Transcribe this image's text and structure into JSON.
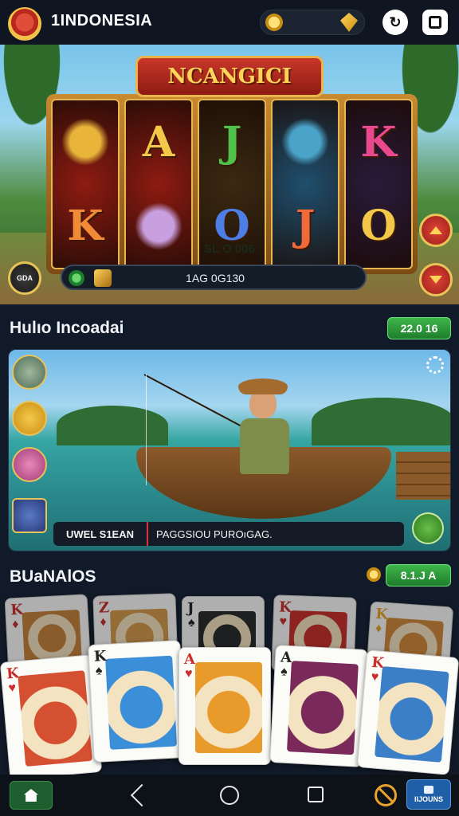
{
  "header": {
    "brand": "1INDONESIA",
    "icons": [
      "avatar",
      "coin-icon",
      "diamond-icon",
      "clock-swap-icon",
      "square-icon"
    ]
  },
  "hero": {
    "title": "NCANGICI",
    "reels": [
      [
        {
          "type": "fish",
          "color": "#e8b43a"
        },
        {
          "type": "letter",
          "text": "K",
          "color": "#f08a36"
        }
      ],
      [
        {
          "type": "letter",
          "text": "A",
          "color": "#f3c84a"
        },
        {
          "type": "fish",
          "color": "#c8a0e0"
        }
      ],
      [
        {
          "type": "letter",
          "text": "J",
          "color": "#4ec24a"
        },
        {
          "type": "letter",
          "text": "O",
          "color": "#4d7ee6"
        }
      ],
      [
        {
          "type": "person",
          "color": "#4aa3c8"
        },
        {
          "type": "letter",
          "text": "J",
          "color": "#f06a3a"
        }
      ],
      [
        {
          "type": "letter",
          "text": "K",
          "color": "#e8488c"
        },
        {
          "type": "letter",
          "text": "O",
          "color": "#f3c84a"
        }
      ]
    ],
    "slot_label": "SL O 006",
    "info_text": "1AG 0G130",
    "left_button_label": "GDA"
  },
  "fishing": {
    "title": "Hulıo Incoadai",
    "badge": "22.0 16",
    "tag": "UWEL  S1EAN",
    "caption": "PAGGSIOU PUROıGAG."
  },
  "cards_section": {
    "title": "BUaNAlOS",
    "badge": "8.1.J A",
    "back_cards": [
      {
        "rank": "K",
        "suit": "♦",
        "color": "#c9302c",
        "art": "#c8823a"
      },
      {
        "rank": "Z",
        "suit": "♦",
        "color": "#c9302c",
        "art": "#d49a4a"
      },
      {
        "rank": "J",
        "suit": "♠",
        "color": "#222222",
        "art": "#2a2a2a"
      },
      {
        "rank": "K",
        "suit": "♥",
        "color": "#c9302c",
        "art": "#c9302c"
      },
      {
        "rank": "K",
        "suit": "♦",
        "color": "#e8a32a",
        "art": "#d28a3a"
      }
    ],
    "front_cards": [
      {
        "rank": "K",
        "suit": "♥",
        "color": "#c9302c",
        "art": "#d45030"
      },
      {
        "rank": "K",
        "suit": "♠",
        "color": "#222222",
        "art": "#3a8fd8"
      },
      {
        "rank": "A",
        "suit": "♥",
        "color": "#c9302c",
        "art": "#e89a2a"
      },
      {
        "rank": "A",
        "suit": "♠",
        "color": "#222222",
        "art": "#7a2a5a"
      },
      {
        "rank": "K",
        "suit": "♥",
        "color": "#c9302c",
        "art": "#3a7fc8"
      }
    ]
  },
  "navbar": {
    "bonus_label": "IIJOUNS"
  }
}
